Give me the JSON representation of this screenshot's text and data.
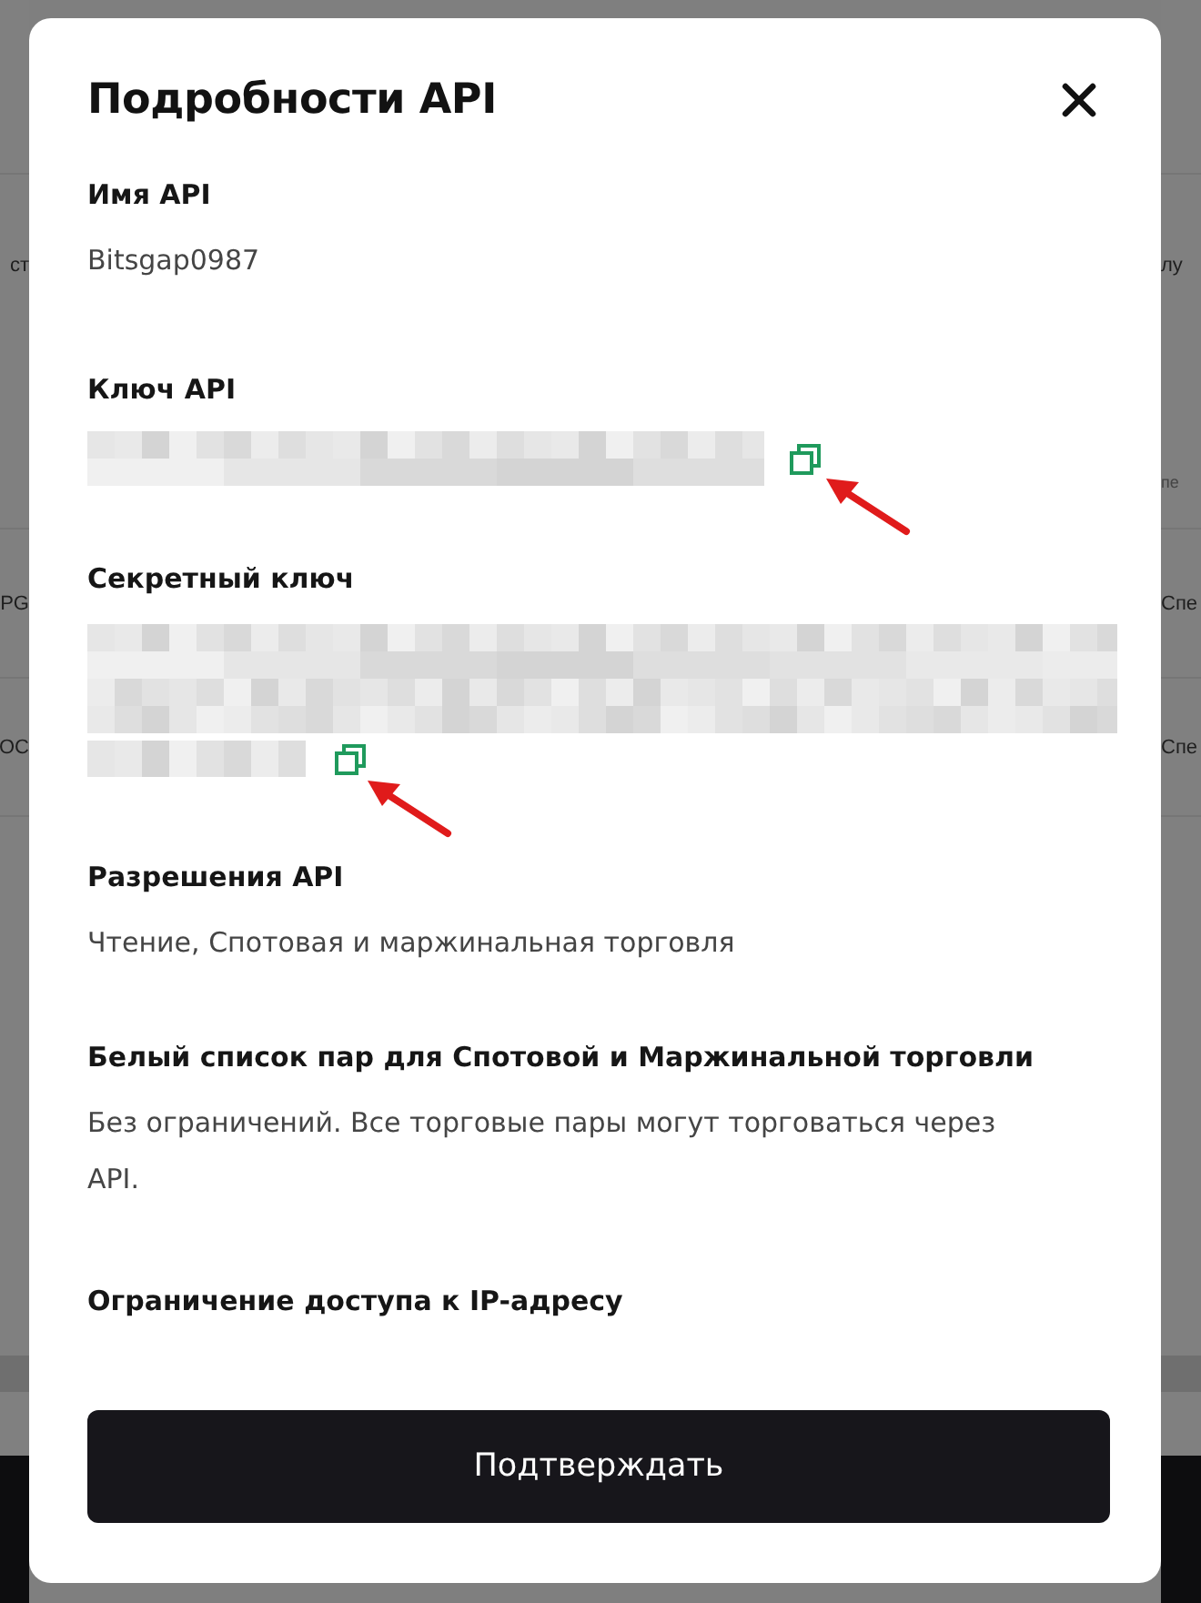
{
  "background_rows": [
    {
      "left": "ст",
      "right": "лу"
    },
    {
      "right": "пе"
    },
    {
      "left": "PG",
      "right": "Спе"
    },
    {
      "left": "OC",
      "right": "Спе"
    }
  ],
  "dialog": {
    "title": "Подробности API",
    "sections": [
      {
        "kind": "text",
        "label": "Имя API",
        "value": "Bitsgap0987"
      },
      {
        "kind": "masked-line",
        "label": "Ключ API",
        "copyable": true,
        "arrow": true
      },
      {
        "kind": "masked-block",
        "label": "Секретный ключ",
        "copyable": true,
        "arrow": true
      },
      {
        "kind": "text",
        "label": "Разрешения API",
        "value": "Чтение, Спотовая и маржинальная торговля"
      },
      {
        "kind": "text",
        "label": "Белый список пар для Спотовой и Маржинальной торговли",
        "value": "Без ограничений. Все торговые пары могут торговаться через API."
      },
      {
        "kind": "text",
        "label": "Ограничение доступа к IP-адресу"
      }
    ],
    "confirm_button": "Подтверждать"
  }
}
